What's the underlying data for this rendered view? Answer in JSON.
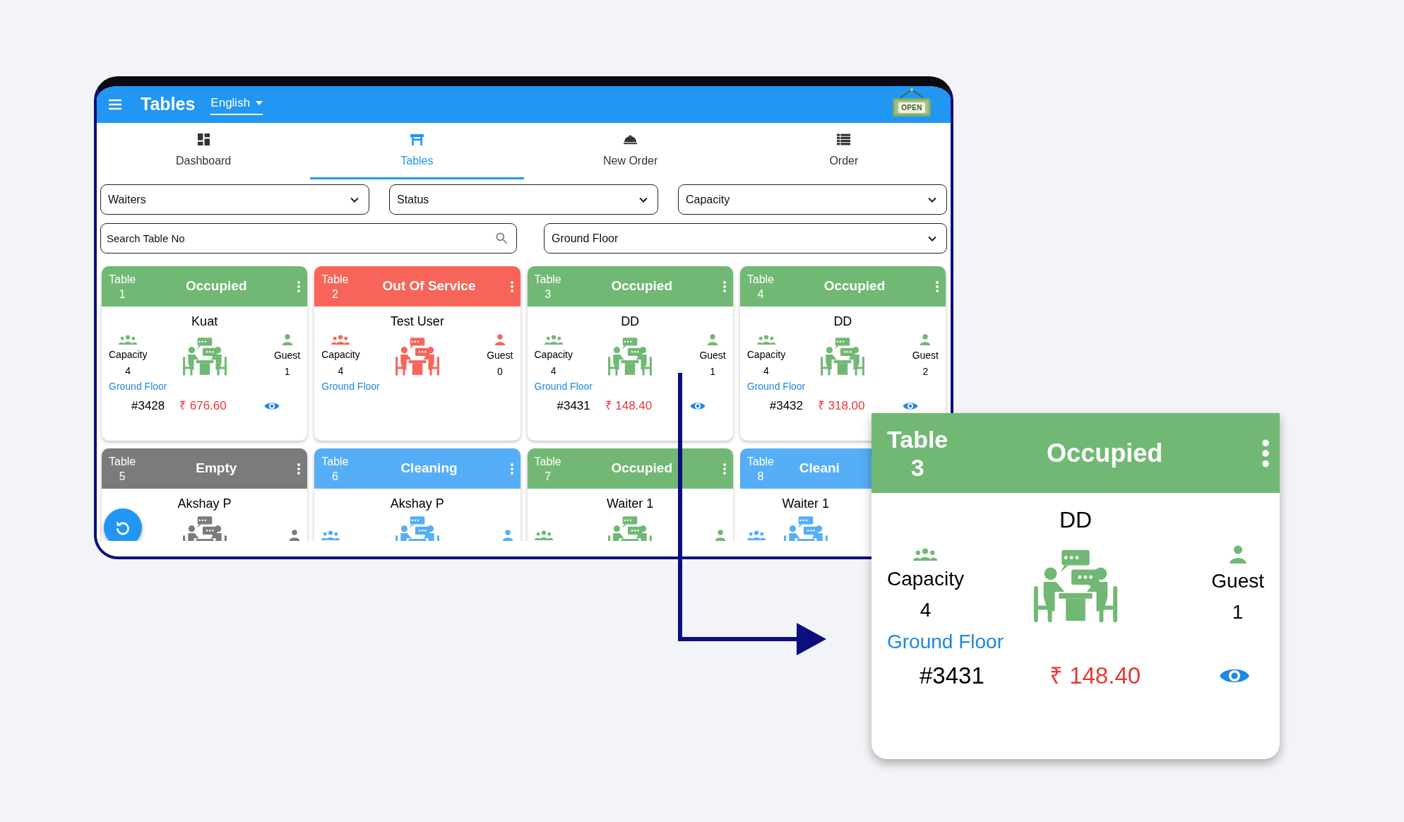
{
  "header": {
    "title": "Tables",
    "language": "English",
    "sign": "OPEN"
  },
  "tabs": [
    {
      "label": "Dashboard",
      "selected": false
    },
    {
      "label": "Tables",
      "selected": true
    },
    {
      "label": "New Order",
      "selected": false
    },
    {
      "label": "Order",
      "selected": false
    }
  ],
  "filters": [
    {
      "label": "Waiters"
    },
    {
      "label": "Status"
    },
    {
      "label": "Capacity"
    }
  ],
  "search": {
    "placeholder": "Search Table No"
  },
  "floor_select": {
    "label": "Ground Floor"
  },
  "tables": [
    {
      "label": "Table",
      "number": "1",
      "status": "Occupied",
      "color": "#71b874",
      "name": "Kuat",
      "capacity_label": "Capacity",
      "capacity": "4",
      "guest_label": "Guest",
      "guests": "1",
      "floor": "Ground Floor",
      "order": "#3428",
      "amount": "₹ 676.60"
    },
    {
      "label": "Table",
      "number": "2",
      "status": "Out Of Service",
      "color": "#f7655a",
      "name": "Test User",
      "capacity_label": "Capacity",
      "capacity": "4",
      "guest_label": "Guest",
      "guests": "0",
      "floor": "Ground Floor"
    },
    {
      "label": "Table",
      "number": "3",
      "status": "Occupied",
      "color": "#71b874",
      "name": "DD",
      "capacity_label": "Capacity",
      "capacity": "4",
      "guest_label": "Guest",
      "guests": "1",
      "floor": "Ground Floor",
      "order": "#3431",
      "amount": "₹ 148.40"
    },
    {
      "label": "Table",
      "number": "4",
      "status": "Occupied",
      "color": "#71b874",
      "name": "DD",
      "capacity_label": "Capacity",
      "capacity": "4",
      "guest_label": "Guest",
      "guests": "2",
      "floor": "Ground Floor",
      "order": "#3432",
      "amount": "₹ 318.00"
    },
    {
      "label": "Table",
      "number": "5",
      "status": "Empty",
      "color": "#7b7b7b",
      "name": "Akshay P"
    },
    {
      "label": "Table",
      "number": "6",
      "status": "Cleaning",
      "color": "#56aef6",
      "name": "Akshay P"
    },
    {
      "label": "Table",
      "number": "7",
      "status": "Occupied",
      "color": "#71b874",
      "name": "Waiter 1"
    },
    {
      "label": "Table",
      "number": "8",
      "status": "Cleani",
      "color": "#56aef6",
      "name": "Waiter 1"
    }
  ],
  "detail_card": {
    "label": "Table",
    "number": "3",
    "status": "Occupied",
    "color": "#71b874",
    "name": "DD",
    "capacity_label": "Capacity",
    "capacity": "4",
    "guest_label": "Guest",
    "guests": "1",
    "floor": "Ground Floor",
    "order": "#3431",
    "amount": "₹ 148.40"
  }
}
